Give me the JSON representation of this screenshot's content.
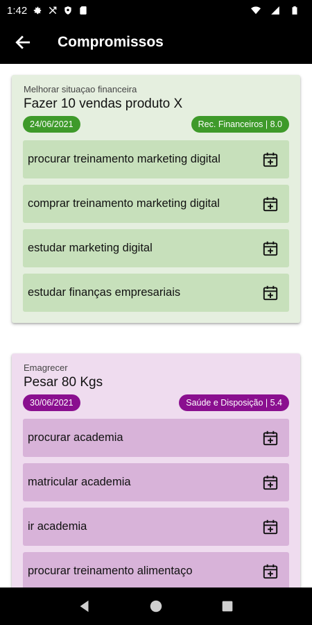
{
  "status_bar": {
    "time": "1:42"
  },
  "app_bar": {
    "title": "Compromissos"
  },
  "goals": [
    {
      "category": "Melhorar situaçao financeira",
      "title": "Fazer 10 vendas produto X",
      "date": "24/06/2021",
      "area": "Rec. Financeiros | 8.0",
      "colors": {
        "card": "#e5efdf",
        "task": "#c7e0bb",
        "chip": "#3e9a2a"
      },
      "tasks": [
        "procurar treinamento marketing digital",
        "comprar treinamento marketing digital",
        "estudar marketing digital",
        "estudar finanças empresariais"
      ]
    },
    {
      "category": "Emagrecer",
      "title": "Pesar 80 Kgs",
      "date": "30/06/2021",
      "area": "Saúde e Disposição | 5.4",
      "colors": {
        "card": "#efdcef",
        "task": "#d8b3d9",
        "chip": "#8a0f8f"
      },
      "tasks": [
        "procurar academia",
        "matricular academia",
        "ir academia",
        "procurar treinamento alimentaço"
      ]
    }
  ],
  "icons": {
    "status": [
      "settings-icon",
      "shuffle-icon",
      "shield-icon",
      "sd-card-icon",
      "wifi-icon",
      "signal-icon",
      "battery-icon"
    ],
    "task_action": "calendar-add-icon",
    "nav": [
      "back-triangle-icon",
      "home-circle-icon",
      "recents-square-icon"
    ]
  }
}
